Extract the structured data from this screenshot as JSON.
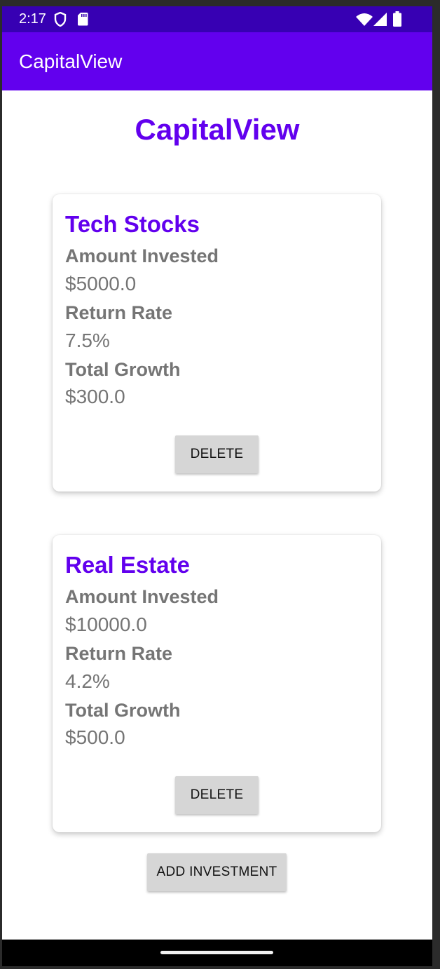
{
  "status_bar": {
    "time": "2:17",
    "left_icons": [
      "shield-icon",
      "sd-card-icon"
    ],
    "right_icons": [
      "wifi-icon",
      "cellular-signal-icon",
      "battery-icon"
    ],
    "color": "#3700b3"
  },
  "app_bar": {
    "title": "CapitalView",
    "color": "#6200ee"
  },
  "main": {
    "title": "CapitalView",
    "title_color": "#6200ee",
    "investments": [
      {
        "name": "Tech Stocks",
        "amount_label": "Amount Invested",
        "amount_value": "$5000.0",
        "rate_label": "Return Rate",
        "rate_value": "7.5%",
        "growth_label": "Total Growth",
        "growth_value": "$300.0",
        "delete_label": "DELETE"
      },
      {
        "name": "Real Estate",
        "amount_label": "Amount Invested",
        "amount_value": "$10000.0",
        "rate_label": "Return Rate",
        "rate_value": "4.2%",
        "growth_label": "Total Growth",
        "growth_value": "$500.0",
        "delete_label": "DELETE"
      }
    ],
    "add_button_label": "ADD INVESTMENT"
  },
  "nav_bar": {
    "color": "#000000"
  }
}
